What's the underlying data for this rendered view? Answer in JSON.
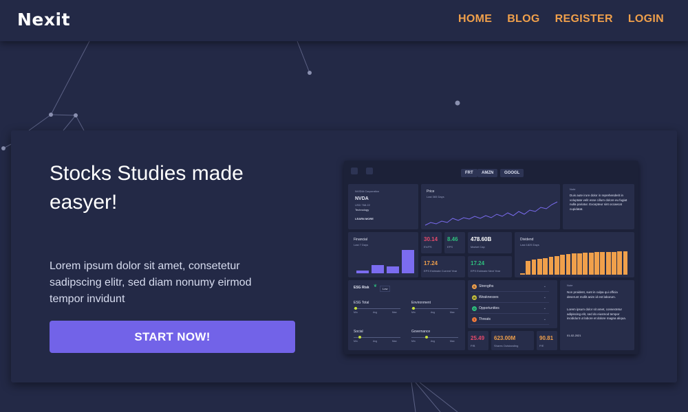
{
  "nav": {
    "logo": "Nexit",
    "links": [
      "HOME",
      "BLOG",
      "REGISTER",
      "LOGIN"
    ]
  },
  "hero": {
    "headline": "Stocks Studies made easyer!",
    "description": "Lorem ipsum dolor sit amet, consetetur sadipscing elitr, sed diam nonumy eirmod tempor invidunt",
    "cta_label": "START NOW!"
  },
  "dashboard": {
    "tickers": [
      "FRT",
      "AMZN",
      "GOOGL"
    ],
    "company": {
      "name_label": "NVIDIA Corporation",
      "ticker": "NVDA",
      "price": "USD 768.22",
      "sector": "Technology",
      "learn_more": "LEARN MORE"
    },
    "price_panel": {
      "title": "Price",
      "subtitle": "Last 365 Days"
    },
    "note_top": {
      "title": "Note",
      "text": "Duis aute irure dolor in reprehenderit in voluptate velit esse cillum dolore eu fugiat nulla pariatur. Excepteur sint occaecat cupidatat."
    },
    "financial": {
      "title": "Financial",
      "subtitle": "Last 7 Days",
      "bars": [
        0.12,
        0.35,
        0.3,
        1.0
      ]
    },
    "metrics_row1": [
      {
        "value": "30.14",
        "label": "EV/FS",
        "color": "#e84a6b"
      },
      {
        "value": "8.46",
        "label": "EPS",
        "color": "#2ec27e"
      },
      {
        "value": "478.60B",
        "label": "Market Cap",
        "color": "#ffffff"
      }
    ],
    "metrics_row2": [
      {
        "value": "17.24",
        "label": "EPS Estimate Current Year",
        "color": "#f0a04b"
      },
      {
        "value": "17.24",
        "label": "EPS Estimate Next Year",
        "color": "#2ec27e"
      }
    ],
    "dividend": {
      "title": "Dividend",
      "subtitle": "Last 1825 Days",
      "bars": [
        0.06,
        0.6,
        0.65,
        0.68,
        0.72,
        0.76,
        0.8,
        0.85,
        0.88,
        0.9,
        0.92,
        0.94,
        0.95,
        0.96,
        0.97,
        0.98,
        0.98,
        0.99,
        1.0
      ]
    },
    "esg": {
      "title": "ESG Risk",
      "badge": "Low",
      "items": [
        {
          "label": "ESG Total",
          "level": 0.05
        },
        {
          "label": "Environment",
          "level": 0.05
        },
        {
          "label": "Social",
          "level": 0.13
        },
        {
          "label": "Governance",
          "level": 0.33
        }
      ],
      "scale": [
        "Min",
        "Avg",
        "Max"
      ]
    },
    "swot": [
      {
        "letter": "S",
        "label": "Strengths",
        "color": "#f0a04b"
      },
      {
        "letter": "W",
        "label": "Weaknesses",
        "color": "#c9c23a"
      },
      {
        "letter": "O",
        "label": "Opportunities",
        "color": "#2ec27e"
      },
      {
        "letter": "T",
        "label": "Threats",
        "color": "#f07a3b"
      }
    ],
    "metrics_bottom": [
      {
        "value": "25.49",
        "label": "P/B",
        "color": "#e84a6b"
      },
      {
        "value": "623.00M",
        "label": "Shares Outstanding",
        "color": "#f0a04b"
      },
      {
        "value": "90.81",
        "label": "P/E",
        "color": "#f0a04b"
      }
    ],
    "note_bottom": {
      "title": "Note",
      "text1": "Non proident, sunt in culpa qui officia deserunt mollit anim id est laborum.",
      "text2": "Lorem ipsum dolor sit amet, consectetur adipiscing elit, sed do eiusmod tempor incididunt ut labore et dolore magna aliqua.",
      "date": "01-02-2021"
    }
  }
}
